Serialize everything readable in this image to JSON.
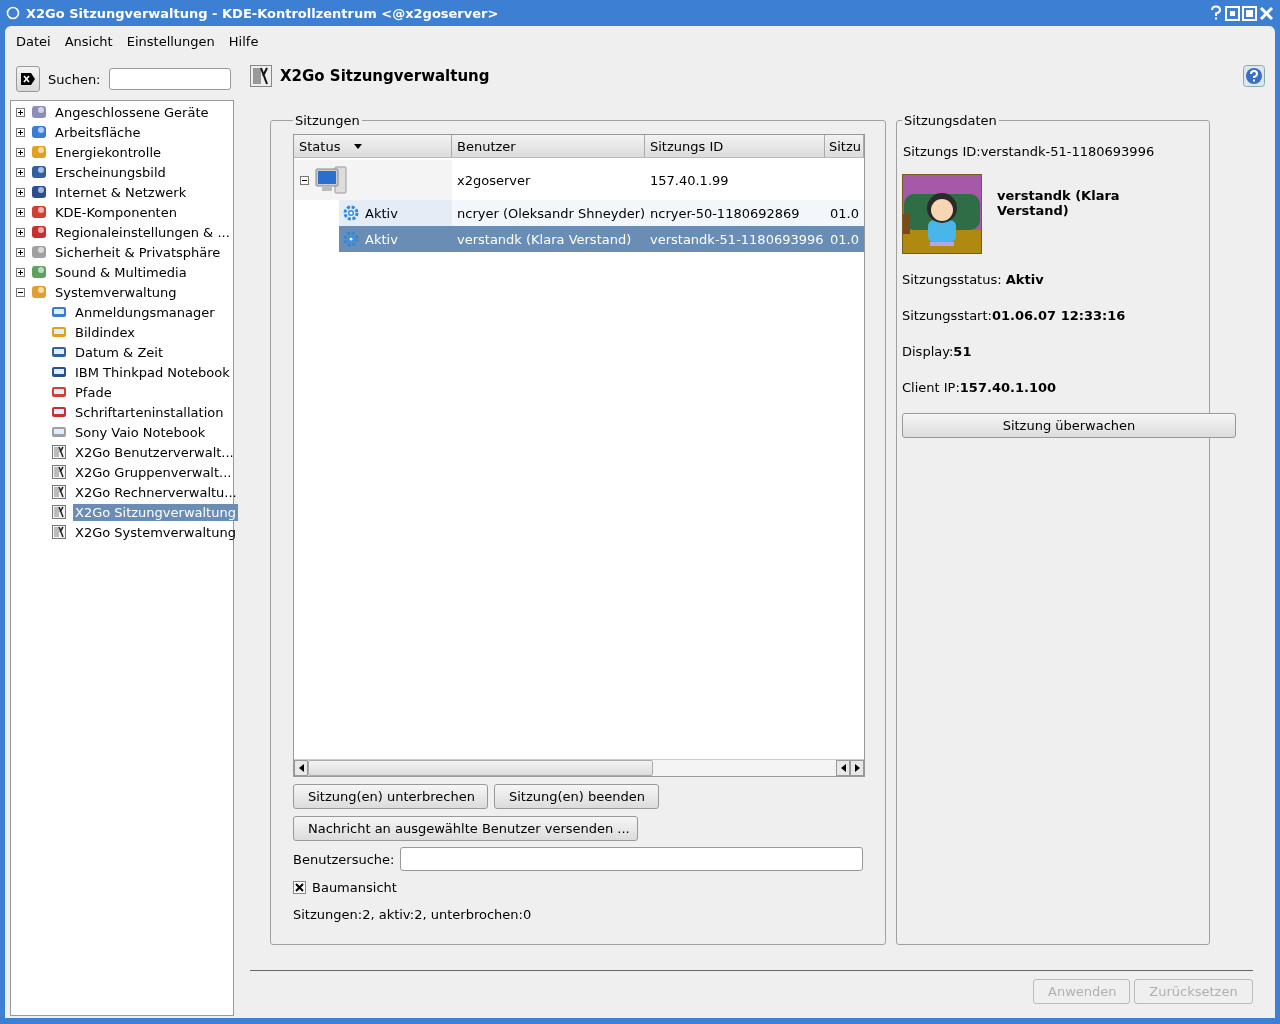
{
  "window": {
    "title": "X2Go Sitzungverwaltung - KDE-Kontrollzentrum <@x2goserver>"
  },
  "menu": [
    "Datei",
    "Ansicht",
    "Einstellungen",
    "Hilfe"
  ],
  "search": {
    "label": "Suchen:"
  },
  "sidebar": {
    "items": [
      {
        "label": "Angeschlossene Geräte",
        "expanded": false,
        "selected": false
      },
      {
        "label": "Arbeitsfläche",
        "expanded": false,
        "selected": false
      },
      {
        "label": "Energiekontrolle",
        "expanded": false,
        "selected": false
      },
      {
        "label": "Erscheinungsbild",
        "expanded": false,
        "selected": false
      },
      {
        "label": "Internet & Netzwerk",
        "expanded": false,
        "selected": false
      },
      {
        "label": "KDE-Komponenten",
        "expanded": false,
        "selected": false
      },
      {
        "label": "Regionaleinstellungen & ...",
        "expanded": false,
        "selected": false
      },
      {
        "label": "Sicherheit & Privatsphäre",
        "expanded": false,
        "selected": false
      },
      {
        "label": "Sound & Multimedia",
        "expanded": false,
        "selected": false
      },
      {
        "label": "Systemverwaltung",
        "expanded": true,
        "selected": false,
        "children": [
          {
            "label": "Anmeldungsmanager",
            "selected": false
          },
          {
            "label": "Bildindex",
            "selected": false
          },
          {
            "label": "Datum & Zeit",
            "selected": false
          },
          {
            "label": "IBM Thinkpad Notebook",
            "selected": false
          },
          {
            "label": "Pfade",
            "selected": false
          },
          {
            "label": "Schriftarteninstallation",
            "selected": false
          },
          {
            "label": "Sony Vaio Notebook",
            "selected": false
          },
          {
            "label": "X2Go Benutzerverwalt...",
            "selected": false
          },
          {
            "label": "X2Go Gruppenverwalt...",
            "selected": false
          },
          {
            "label": "X2Go Rechnerverwaltu...",
            "selected": false
          },
          {
            "label": "X2Go Sitzungverwaltung",
            "selected": true
          },
          {
            "label": "X2Go Systemverwaltung",
            "selected": false
          }
        ]
      }
    ]
  },
  "page": {
    "title": "X2Go Sitzungverwaltung"
  },
  "sessions": {
    "title": "Sitzungen",
    "columns": [
      "Status",
      "Benutzer",
      "Sitzungs ID",
      "Sitzu"
    ],
    "hosts": [
      {
        "name": "x2goserver",
        "address": "157.40.1.99",
        "expanded": true,
        "sessions": [
          {
            "status": "Aktiv",
            "user": "ncryer (Oleksandr Shneyder)",
            "id": "ncryer-50-1180692869",
            "column_4": "01.0",
            "selected": false
          },
          {
            "status": "Aktiv",
            "user": "verstandk (Klara Verstand)",
            "id": "verstandk-51-1180693996",
            "column_4": "01.0",
            "selected": true
          }
        ]
      }
    ],
    "buttons": [
      "Sitzung(en) unterbrechen",
      "Sitzung(en) beenden",
      "Nachricht an ausgewählte Benutzer versenden ..."
    ],
    "user_search": {
      "label": "Benutzersuche:"
    },
    "tree_view": {
      "label": "Baumansicht",
      "checked": true
    },
    "summary": "Sitzungen:2, aktiv:2, unterbrochen:0"
  },
  "details": {
    "title": "Sitzungsdaten",
    "session_id": "Sitzungs ID:verstandk-51-1180693996",
    "user": "verstandk (Klara Verstand)",
    "lines": [
      "Sitzungsstatus: **Aktiv**",
      "Sitzungsstart:**01.06.07 12:33:16**",
      "Display:**51**",
      "Client IP:**157.40.1.100**"
    ],
    "button": "Sitzung überwachen"
  },
  "footer": {
    "buttons": [
      {
        "label": "Anwenden",
        "disabled": true
      },
      {
        "label": "Zurücksetzen",
        "disabled": true
      }
    ]
  }
}
